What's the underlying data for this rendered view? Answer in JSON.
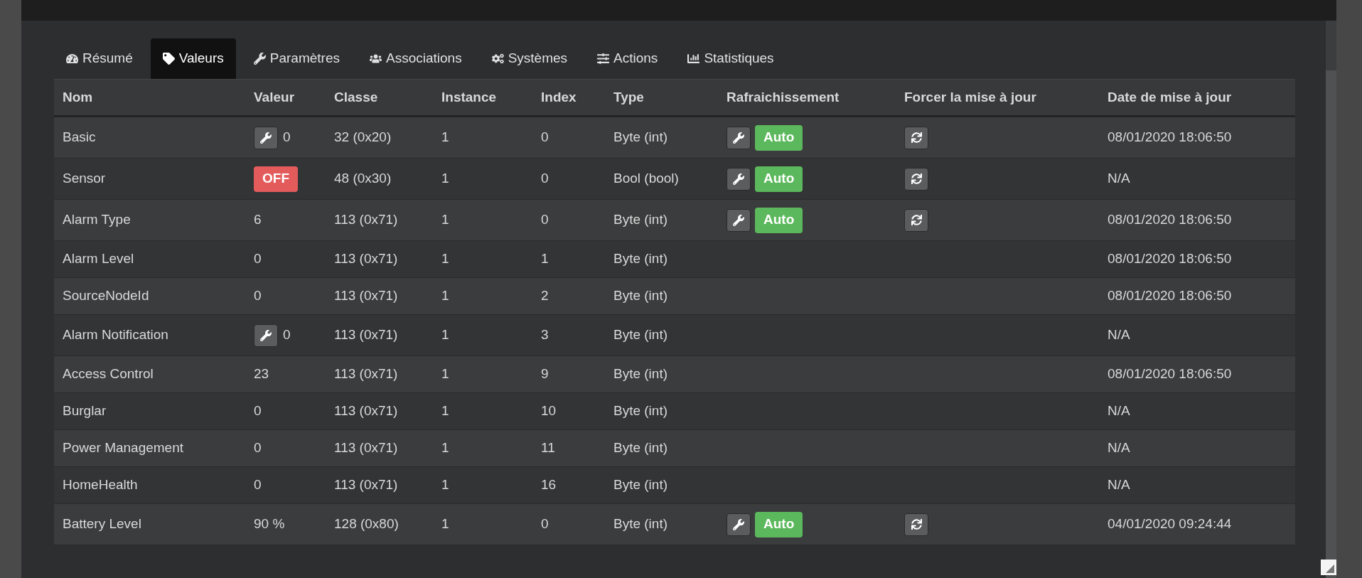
{
  "tabs": [
    {
      "label": "Résumé",
      "selected": false
    },
    {
      "label": "Valeurs",
      "selected": true
    },
    {
      "label": "Paramètres",
      "selected": false
    },
    {
      "label": "Associations",
      "selected": false
    },
    {
      "label": "Systèmes",
      "selected": false
    },
    {
      "label": "Actions",
      "selected": false
    },
    {
      "label": "Statistiques",
      "selected": false
    }
  ],
  "table": {
    "columns": [
      "Nom",
      "Valeur",
      "Classe",
      "Instance",
      "Index",
      "Type",
      "Rafraichissement",
      "Forcer la mise à jour",
      "Date de mise à jour"
    ],
    "rows": [
      {
        "name": "Basic",
        "value": {
          "kind": "editable",
          "text": "0"
        },
        "class": "32 (0x20)",
        "instance": "1",
        "index": "0",
        "type": "Byte (int)",
        "refresh": "Auto",
        "force_refresh": true,
        "date": "08/01/2020 18:06:50"
      },
      {
        "name": "Sensor",
        "value": {
          "kind": "toggle",
          "text": "OFF"
        },
        "class": "48 (0x30)",
        "instance": "1",
        "index": "0",
        "type": "Bool (bool)",
        "refresh": "Auto",
        "force_refresh": true,
        "date": "N/A"
      },
      {
        "name": "Alarm Type",
        "value": {
          "kind": "plain",
          "text": "6"
        },
        "class": "113 (0x71)",
        "instance": "1",
        "index": "0",
        "type": "Byte (int)",
        "refresh": "Auto",
        "force_refresh": true,
        "date": "08/01/2020 18:06:50"
      },
      {
        "name": "Alarm Level",
        "value": {
          "kind": "plain",
          "text": "0"
        },
        "class": "113 (0x71)",
        "instance": "1",
        "index": "1",
        "type": "Byte (int)",
        "force_refresh": false,
        "date": "08/01/2020 18:06:50"
      },
      {
        "name": "SourceNodeId",
        "value": {
          "kind": "plain",
          "text": "0"
        },
        "class": "113 (0x71)",
        "instance": "1",
        "index": "2",
        "type": "Byte (int)",
        "force_refresh": false,
        "date": "08/01/2020 18:06:50"
      },
      {
        "name": "Alarm Notification",
        "value": {
          "kind": "editable",
          "text": "0"
        },
        "class": "113 (0x71)",
        "instance": "1",
        "index": "3",
        "type": "Byte (int)",
        "force_refresh": false,
        "date": "N/A"
      },
      {
        "name": "Access Control",
        "value": {
          "kind": "plain",
          "text": "23"
        },
        "class": "113 (0x71)",
        "instance": "1",
        "index": "9",
        "type": "Byte (int)",
        "force_refresh": false,
        "date": "08/01/2020 18:06:50"
      },
      {
        "name": "Burglar",
        "value": {
          "kind": "plain",
          "text": "0"
        },
        "class": "113 (0x71)",
        "instance": "1",
        "index": "10",
        "type": "Byte (int)",
        "force_refresh": false,
        "date": "N/A"
      },
      {
        "name": "Power Management",
        "value": {
          "kind": "plain",
          "text": "0"
        },
        "class": "113 (0x71)",
        "instance": "1",
        "index": "11",
        "type": "Byte (int)",
        "force_refresh": false,
        "date": "N/A"
      },
      {
        "name": "HomeHealth",
        "value": {
          "kind": "plain",
          "text": "0"
        },
        "class": "113 (0x71)",
        "instance": "1",
        "index": "16",
        "type": "Byte (int)",
        "force_refresh": false,
        "date": "N/A"
      },
      {
        "name": "Battery Level",
        "value": {
          "kind": "plain",
          "text": "90 %"
        },
        "class": "128 (0x80)",
        "instance": "1",
        "index": "0",
        "type": "Byte (int)",
        "refresh": "Auto",
        "force_refresh": true,
        "date": "04/01/2020 09:24:44"
      }
    ]
  }
}
